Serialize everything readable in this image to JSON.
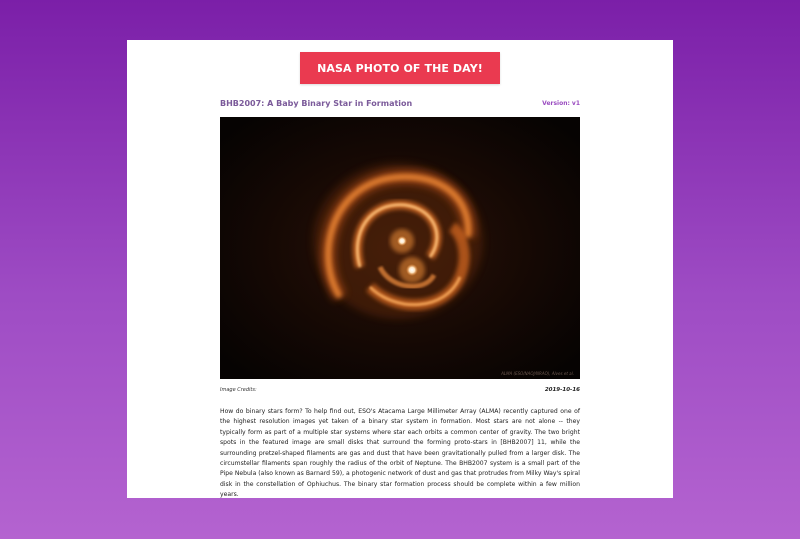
{
  "header": {
    "button_label": "NASA PHOTO OF THE DAY!"
  },
  "photo": {
    "title": "BHB2007: A Baby Binary Star in Formation",
    "version_label": "Version:",
    "version_value": "v1",
    "watermark": "ALMA (ESO/NAOJ/NRAO), Alves et al.",
    "credits_label": "Image Credits:",
    "date": "2019-10-16",
    "description": "How do binary stars form? To help find out, ESO's Atacama Large Millimeter Array (ALMA) recently captured one of the highest resolution images yet taken of a binary star system in formation. Most stars are not alone -- they typically form as part of a multiple star systems where star each orbits a common center of gravity. The two bright spots in the featured image are small disks that surround the forming proto-stars in [BHB2007] 11, while the surrounding pretzel-shaped filaments are gas and dust that have been gravitationally pulled from a larger disk. The circumstellar filaments span roughly the radius of the orbit of Neptune. The BHB2007 system is a small part of the Pipe Nebula (also known as Barnard 59), a photogenic network of dust and gas that protrudes from Milky Way's spiral disk in the constellation of Ophiuchus. The binary star formation process should be complete within a few million years."
  },
  "colors": {
    "button": "#ea3a50",
    "title": "#7b5a9a",
    "version": "#9a4cc0",
    "background_top": "#7b1fa8",
    "background_bottom": "#b463d0"
  }
}
